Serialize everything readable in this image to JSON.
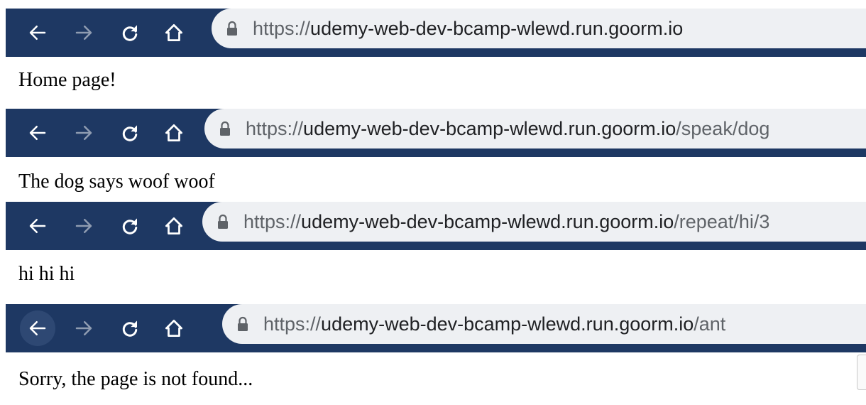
{
  "colors": {
    "toolbar_bg": "#1e3863",
    "url_bg": "#eef0f3",
    "url_host": "#202124",
    "url_dim": "#5f6368",
    "icon": "#ffffff"
  },
  "icons": [
    "back-arrow-icon",
    "forward-arrow-icon",
    "reload-icon",
    "home-icon",
    "lock-icon"
  ],
  "screens": [
    {
      "url": {
        "scheme": "https://",
        "host": "udemy-web-dev-bcamp-wlewd.run.goorm.io",
        "path": ""
      },
      "text": "Home page!"
    },
    {
      "url": {
        "scheme": "https://",
        "host": "udemy-web-dev-bcamp-wlewd.run.goorm.io",
        "path": "/speak/dog"
      },
      "text": "The dog says woof woof"
    },
    {
      "url": {
        "scheme": "https://",
        "host": "udemy-web-dev-bcamp-wlewd.run.goorm.io",
        "path": "/repeat/hi/3"
      },
      "text": "hi hi hi"
    },
    {
      "url": {
        "scheme": "https://",
        "host": "udemy-web-dev-bcamp-wlewd.run.goorm.io",
        "path": "/ant"
      },
      "text": "Sorry, the page is not found..."
    }
  ]
}
